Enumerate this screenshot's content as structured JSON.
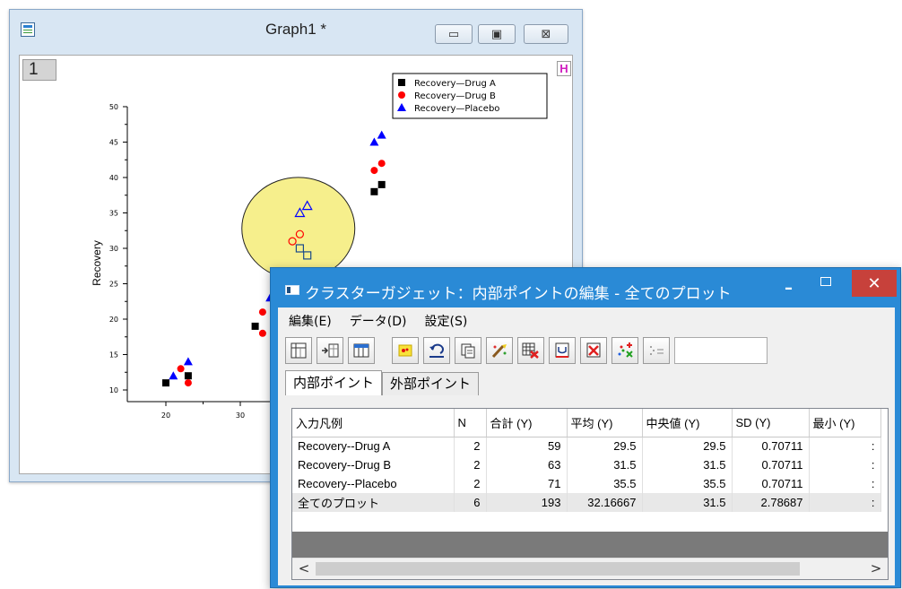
{
  "graph_window": {
    "title": "Graph1 *",
    "layer_tab": "1",
    "h_badge": "H",
    "controls": {
      "minimize": "▭",
      "maximize": "▣",
      "close": "⊠"
    }
  },
  "chart_data": {
    "type": "scatter",
    "title": "",
    "xlabel": "",
    "ylabel": "Recovery",
    "xlim": [
      15,
      50
    ],
    "ylim": [
      8,
      50
    ],
    "y_ticks": [
      10,
      15,
      20,
      25,
      30,
      35,
      40,
      45,
      50
    ],
    "x_ticks": [
      20,
      30
    ],
    "legend": {
      "position": "top-right"
    },
    "series": [
      {
        "name": "Recovery—Drug A",
        "marker": "square",
        "color": "#000000",
        "points": [
          [
            20,
            11
          ],
          [
            23,
            12
          ],
          [
            32,
            19
          ],
          [
            38,
            30
          ],
          [
            39,
            29
          ],
          [
            48,
            38
          ],
          [
            49,
            39
          ]
        ]
      },
      {
        "name": "Recovery—Drug B",
        "marker": "circle",
        "color": "#ff0000",
        "points": [
          [
            22,
            13
          ],
          [
            23,
            11
          ],
          [
            33,
            21
          ],
          [
            33,
            18
          ],
          [
            37,
            31
          ],
          [
            38,
            32
          ],
          [
            48,
            41
          ],
          [
            49,
            42
          ]
        ]
      },
      {
        "name": "Recovery—Placebo",
        "marker": "triangle",
        "color": "#0000ff",
        "points": [
          [
            21,
            12
          ],
          [
            23,
            14
          ],
          [
            34,
            23
          ],
          [
            38,
            35
          ],
          [
            39,
            36
          ],
          [
            48,
            45
          ],
          [
            49,
            46
          ]
        ]
      }
    ],
    "selected_points_hollow": [
      [
        38,
        30
      ],
      [
        39,
        29
      ],
      [
        37,
        31
      ],
      [
        38,
        32
      ],
      [
        38,
        35
      ],
      [
        39,
        36
      ]
    ],
    "selection_circle": {
      "fill": "#f6ef8c"
    }
  },
  "dialog": {
    "title": "クラスターガジェット：内部ポイントの編集 - 全てのプロット",
    "close_symbol": "✕",
    "pin_symbol": "–",
    "menu": [
      "編集(E)",
      "データ(D)",
      "設定(S)"
    ],
    "toolbar_icons": [
      "worksheet-icon",
      "append-icon",
      "columns-icon",
      "select-points-icon",
      "undo-icon",
      "copy-icon",
      "mask-icon",
      "delete-grid-icon",
      "extract-icon",
      "remove-icon",
      "scatter-add-icon",
      "scatter-options-icon"
    ],
    "tabs": [
      "内部ポイント",
      "外部ポイント"
    ],
    "table": {
      "columns": [
        "入力凡例",
        "N",
        "合計 (Y)",
        "平均 (Y)",
        "中央値 (Y)",
        "SD (Y)",
        "最小 (Y)"
      ],
      "rows": [
        [
          "Recovery--Drug A",
          "2",
          "59",
          "29.5",
          "29.5",
          "0.70711",
          ":"
        ],
        [
          "Recovery--Drug B",
          "2",
          "63",
          "31.5",
          "31.5",
          "0.70711",
          ":"
        ],
        [
          "Recovery--Placebo",
          "2",
          "71",
          "35.5",
          "35.5",
          "0.70711",
          ":"
        ],
        [
          "全てのプロット",
          "6",
          "193",
          "32.16667",
          "31.5",
          "2.78687",
          ":"
        ]
      ]
    },
    "scroll": {
      "left": "<",
      "right": ">"
    }
  }
}
